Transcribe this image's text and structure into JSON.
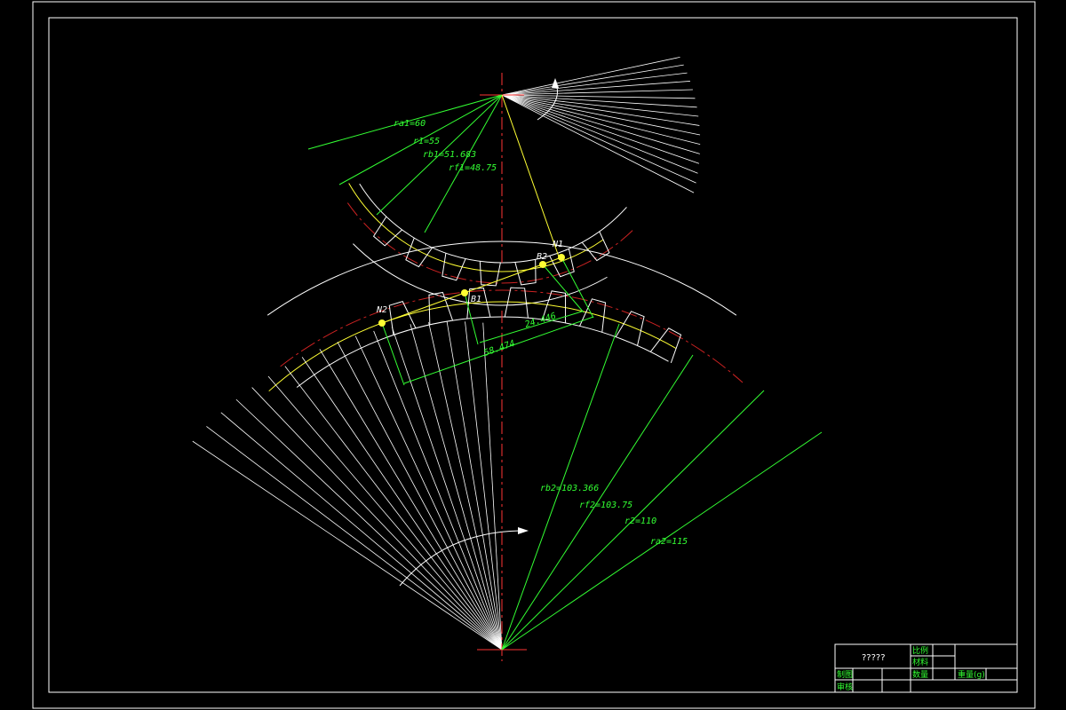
{
  "drawing": {
    "dimensions": {
      "pinion": [
        "ra1=60",
        "r1=55",
        "rb1=51.683",
        "rf1=48.75"
      ],
      "gear": [
        "rb2=103.366",
        "rf2=103.75",
        "r2=110",
        "ra2=115"
      ],
      "line_lengths": [
        "24.446",
        "58.474"
      ]
    },
    "points": [
      "B2",
      "N1",
      "B1",
      "N2"
    ],
    "title_block": {
      "title": "?????",
      "scale_label": "比例",
      "material_label": "材料",
      "quantity_label": "数量",
      "weight_label": "重量(g)",
      "drawn_label": "制图",
      "checked_label": "审核"
    },
    "colors": {
      "background": "#000000",
      "outline": "#ffffff",
      "dimension": "#33ff33",
      "centerline": "#ff3333",
      "pitch_circle": "#cc2222",
      "path_of_contact": "#ffff33"
    }
  }
}
